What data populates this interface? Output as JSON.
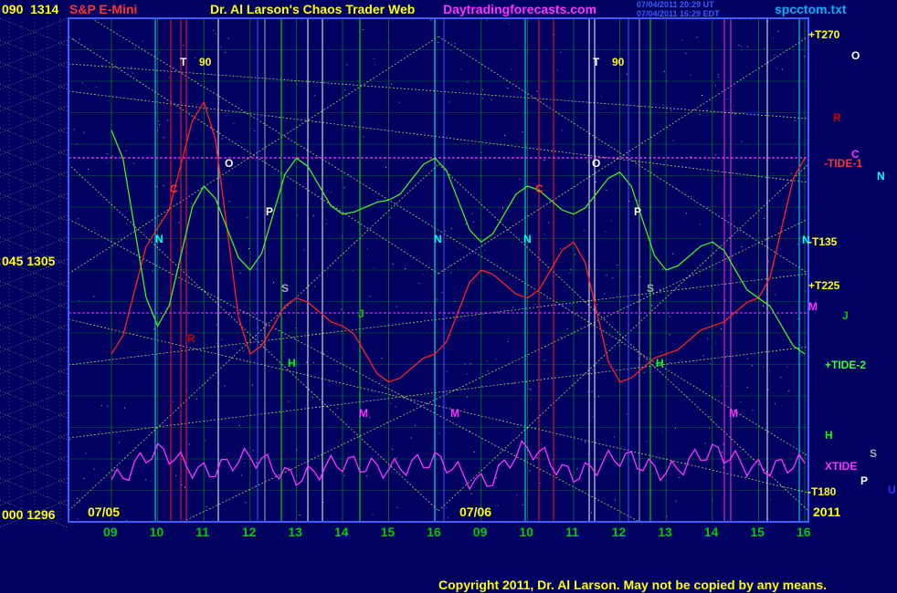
{
  "header": {
    "code": "090",
    "price": "1314",
    "symbol": "S&P E-Mini",
    "title": "Dr. Al Larson's Chaos Trader Web",
    "site": "Daytradingforecasts.com",
    "stamp1": "07/04/2011 20:29 UT",
    "stamp2": "07/04/2011 16:29 EDT",
    "file": "spcctom.txt"
  },
  "y_axis": {
    "left_labels": [
      {
        "text": "090  1314",
        "value": 1314
      },
      {
        "text": "045  1305",
        "value": 1305
      },
      {
        "text": "000  1296",
        "value": 1296
      }
    ]
  },
  "x_axis": {
    "date_labels": [
      "07/05",
      "07/06"
    ],
    "hour_ticks": [
      "09",
      "10",
      "11",
      "12",
      "13",
      "14",
      "15",
      "16",
      "09",
      "10",
      "11",
      "12",
      "13",
      "14",
      "15",
      "16"
    ],
    "year": "2011"
  },
  "right_labels": [
    {
      "text": "+T270",
      "color": "#ffff00"
    },
    {
      "text": "O",
      "color": "#ffffff"
    },
    {
      "text": "R",
      "color": "#cc0000"
    },
    {
      "text": "C",
      "color": "#ff33ff"
    },
    {
      "text": "-TIDE-1",
      "color": "#ff3333"
    },
    {
      "text": "N",
      "color": "#00ffff"
    },
    {
      "text": "N",
      "color": "#00ffff"
    },
    {
      "text": "-T135",
      "color": "#ffff00"
    },
    {
      "text": "+T225",
      "color": "#ffff00"
    },
    {
      "text": "M",
      "color": "#ff33ff"
    },
    {
      "text": "J",
      "color": "#00cc00"
    },
    {
      "text": "+TIDE-2",
      "color": "#33ff33"
    },
    {
      "text": "H",
      "color": "#00ff00"
    },
    {
      "text": "S",
      "color": "#aaaaaa"
    },
    {
      "text": "XTIDE",
      "color": "#ff33ff"
    },
    {
      "text": "P",
      "color": "#ffffff"
    },
    {
      "text": "-T180",
      "color": "#ffff00"
    },
    {
      "text": "U",
      "color": "#3333ff"
    }
  ],
  "planet_markers": [
    {
      "text": "T",
      "color": "#ffffff"
    },
    {
      "text": "90",
      "color": "#ffff00"
    },
    {
      "text": "C",
      "color": "#ff3333"
    },
    {
      "text": "O",
      "color": "#ffffff"
    },
    {
      "text": "N",
      "color": "#00ffff"
    },
    {
      "text": "P",
      "color": "#ffffff"
    },
    {
      "text": "S",
      "color": "#aaaaaa"
    },
    {
      "text": "R",
      "color": "#cc0000"
    },
    {
      "text": "J",
      "color": "#00cc00"
    },
    {
      "text": "H",
      "color": "#00ff00"
    },
    {
      "text": "M",
      "color": "#ff33ff"
    },
    {
      "text": "N",
      "color": "#00ffff"
    },
    {
      "text": "M",
      "color": "#ff33ff"
    },
    {
      "text": "T",
      "color": "#ffffff"
    },
    {
      "text": "90",
      "color": "#ffff00"
    },
    {
      "text": "C",
      "color": "#ff3333"
    },
    {
      "text": "O",
      "color": "#ffffff"
    },
    {
      "text": "N",
      "color": "#00ffff"
    },
    {
      "text": "P",
      "color": "#ffffff"
    },
    {
      "text": "S",
      "color": "#aaaaaa"
    },
    {
      "text": "H",
      "color": "#00ff00"
    },
    {
      "text": "M",
      "color": "#ff33ff"
    }
  ],
  "copyright": "Copyright 2011, Dr. Al Larson. May not be copied by any means.",
  "colors": {
    "background": "#000060",
    "border": "#3a5fff",
    "grid_h": "#00cc00",
    "grid_v": "#00cc00",
    "price_line": "#ff2020",
    "tide_line": "#44ee22",
    "xtide_line": "#ff33ff",
    "diag": "#e8e870",
    "title": "#ffff00",
    "symbol": "#ff3333",
    "site": "#ff33ff",
    "file": "#00b0ff"
  },
  "chart_data": {
    "type": "line",
    "ylim": [
      1296,
      1314
    ],
    "x": [
      "07/05 09:00",
      "07/05 10:00",
      "07/05 11:00",
      "07/05 12:00",
      "07/05 13:00",
      "07/05 14:00",
      "07/05 15:00",
      "07/05 16:00",
      "07/06 09:00",
      "07/06 10:00",
      "07/06 11:00",
      "07/06 12:00",
      "07/06 13:00",
      "07/06 14:00",
      "07/06 15:00",
      "07/06 16:00"
    ],
    "series": [
      {
        "values": [
          1302,
          1306.5,
          1311,
          1302,
          1304,
          1303,
          1301,
          1302,
          1305,
          1304,
          1306,
          1301,
          1302,
          1303,
          1304,
          1309
        ]
      },
      {
        "values": [
          1310,
          1303,
          1308,
          1305,
          1309,
          1307,
          1307.5,
          1309,
          1306,
          1308,
          1307,
          1308.5,
          1305,
          1306,
          1304,
          1302
        ]
      },
      {
        "values": [
          1297.5,
          1298.5,
          1297.8,
          1298.3,
          1297.6,
          1298.1,
          1297.9,
          1298.2,
          1297.4,
          1298.6,
          1297.7,
          1298.3,
          1297.8,
          1298.5,
          1297.9,
          1298.1
        ]
      }
    ]
  }
}
